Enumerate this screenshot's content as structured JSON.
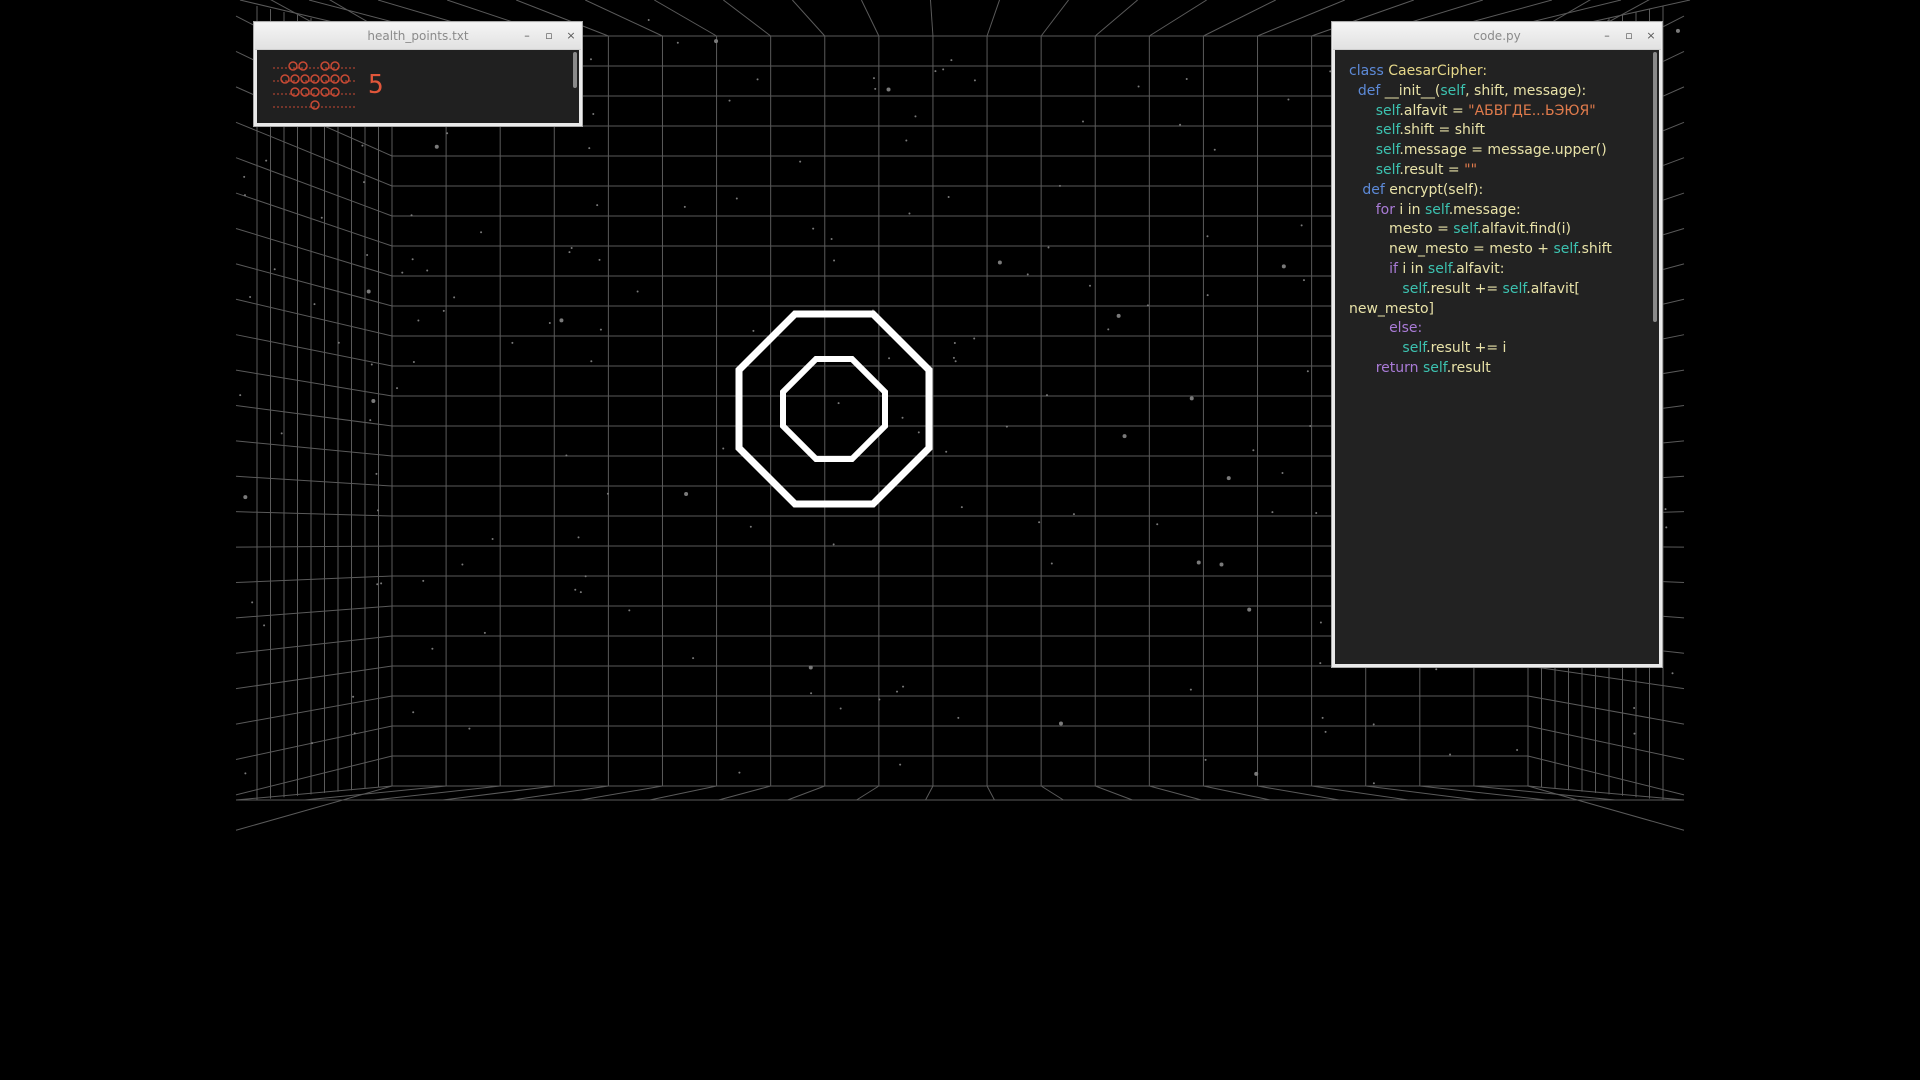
{
  "windows": {
    "health": {
      "title": "health_points.txt",
      "value": "5",
      "accent_color": "#e0563a"
    },
    "code": {
      "title": "code.py",
      "lines": [
        [
          {
            "t": "class ",
            "c": "kw"
          },
          {
            "t": "CaesarCipher:",
            "c": "cls"
          }
        ],
        [
          {
            "t": "  def ",
            "c": "kw"
          },
          {
            "t": "__init__(",
            "c": ""
          },
          {
            "t": "self",
            "c": "slf"
          },
          {
            "t": ", shift, message):",
            "c": ""
          }
        ],
        [
          {
            "t": "      ",
            "c": ""
          },
          {
            "t": "self",
            "c": "slf"
          },
          {
            "t": ".alfavit = ",
            "c": ""
          },
          {
            "t": "\"АБВГДЕ...ЬЭЮЯ\"",
            "c": "str"
          }
        ],
        [
          {
            "t": "      ",
            "c": ""
          },
          {
            "t": "self",
            "c": "slf"
          },
          {
            "t": ".shift = shift",
            "c": ""
          }
        ],
        [
          {
            "t": "      ",
            "c": ""
          },
          {
            "t": "self",
            "c": "slf"
          },
          {
            "t": ".message = message.upper()",
            "c": ""
          }
        ],
        [
          {
            "t": "      ",
            "c": ""
          },
          {
            "t": "self",
            "c": "slf"
          },
          {
            "t": ".result = ",
            "c": ""
          },
          {
            "t": "\"\"",
            "c": "str"
          }
        ],
        [
          {
            "t": "   def ",
            "c": "kw"
          },
          {
            "t": "encrypt(self):",
            "c": ""
          }
        ],
        [
          {
            "t": "      ",
            "c": ""
          },
          {
            "t": "for",
            "c": "kw2"
          },
          {
            "t": " i in ",
            "c": ""
          },
          {
            "t": "self",
            "c": "slf"
          },
          {
            "t": ".message:",
            "c": ""
          }
        ],
        [
          {
            "t": "         mesto = ",
            "c": ""
          },
          {
            "t": "self",
            "c": "slf"
          },
          {
            "t": ".alfavit.find(i)",
            "c": ""
          }
        ],
        [
          {
            "t": "         new_mesto = mesto + ",
            "c": ""
          },
          {
            "t": "self",
            "c": "slf"
          },
          {
            "t": ".shift",
            "c": ""
          }
        ],
        [
          {
            "t": "         ",
            "c": ""
          },
          {
            "t": "if",
            "c": "kw2"
          },
          {
            "t": " i in ",
            "c": ""
          },
          {
            "t": "self",
            "c": "slf"
          },
          {
            "t": ".alfavit:",
            "c": ""
          }
        ],
        [
          {
            "t": "            ",
            "c": ""
          },
          {
            "t": "self",
            "c": "slf"
          },
          {
            "t": ".result += ",
            "c": ""
          },
          {
            "t": "self",
            "c": "slf"
          },
          {
            "t": ".alfavit[",
            "c": ""
          }
        ],
        [
          {
            "t": "new_mesto]",
            "c": ""
          }
        ],
        [
          {
            "t": "         ",
            "c": ""
          },
          {
            "t": "else:",
            "c": "kw2"
          }
        ],
        [
          {
            "t": "            ",
            "c": ""
          },
          {
            "t": "self",
            "c": "slf"
          },
          {
            "t": ".result += i",
            "c": ""
          }
        ],
        [
          {
            "t": "      ",
            "c": ""
          },
          {
            "t": "return ",
            "c": "kw2"
          },
          {
            "t": "self",
            "c": "slf"
          },
          {
            "t": ".result",
            "c": ""
          }
        ]
      ]
    },
    "controls": {
      "minimize": "–",
      "maximize": "▫",
      "close": "×"
    }
  },
  "scene": {
    "grid_color": "#5a5a5a",
    "target_icon": "octagon-ring-icon"
  }
}
